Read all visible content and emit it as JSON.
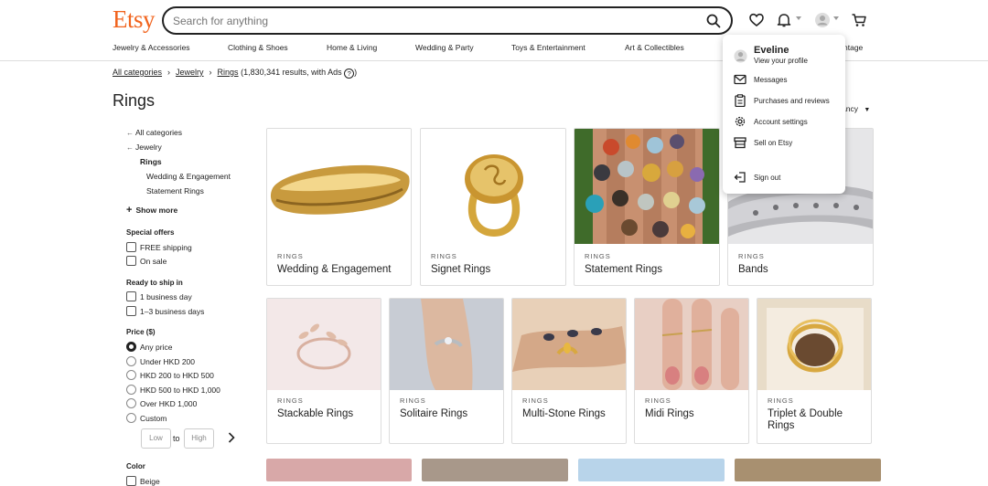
{
  "header": {
    "logo": "Etsy",
    "search_placeholder": "Search for anything",
    "categories": [
      "Jewelry & Accessories",
      "Clothing & Shoes",
      "Home & Living",
      "Wedding & Party",
      "Toys & Entertainment",
      "Art & Collectibles",
      "ntage"
    ]
  },
  "breadcrumb": {
    "items": [
      "All categories",
      "Jewelry",
      "Rings"
    ],
    "results": "(1,830,341 results, with Ads",
    "help_icon": "?",
    "close": ")"
  },
  "page_title": "Rings",
  "sort_label": "ancy",
  "sidebar": {
    "nav": [
      "All categories",
      "Jewelry",
      "Rings",
      "Wedding & Engagement",
      "Statement Rings"
    ],
    "show_more": "Show more",
    "special_offers": {
      "title": "Special offers",
      "options": [
        "FREE shipping",
        "On sale"
      ]
    },
    "ready_to_ship": {
      "title": "Ready to ship in",
      "options": [
        "1 business day",
        "1–3 business days"
      ]
    },
    "price": {
      "title": "Price ($)",
      "options": [
        "Any price",
        "Under HKD 200",
        "HKD 200 to HKD 500",
        "HKD 500 to HKD 1,000",
        "Over HKD 1,000",
        "Custom"
      ],
      "selected": "Any price",
      "low_placeholder": "Low",
      "to": "to",
      "high_placeholder": "High"
    },
    "color": {
      "title": "Color",
      "options": [
        "Beige"
      ]
    }
  },
  "cards": [
    {
      "kicker": "RINGS",
      "title": "Wedding & Engagement"
    },
    {
      "kicker": "RINGS",
      "title": "Signet Rings"
    },
    {
      "kicker": "RINGS",
      "title": "Statement Rings"
    },
    {
      "kicker": "RINGS",
      "title": "Bands"
    },
    {
      "kicker": "RINGS",
      "title": "Stackable Rings"
    },
    {
      "kicker": "RINGS",
      "title": "Solitaire Rings"
    },
    {
      "kicker": "RINGS",
      "title": "Multi-Stone Rings"
    },
    {
      "kicker": "RINGS",
      "title": "Midi Rings"
    },
    {
      "kicker": "RINGS",
      "title": "Triplet & Double Rings"
    }
  ],
  "account_menu": {
    "name": "Eveline",
    "profile_link": "View your profile",
    "items": [
      "Messages",
      "Purchases and reviews",
      "Account settings",
      "Sell on Etsy",
      "Sign out"
    ]
  },
  "colors": {
    "brand": "#f1641e",
    "text": "#222222",
    "border": "#dddddd"
  }
}
